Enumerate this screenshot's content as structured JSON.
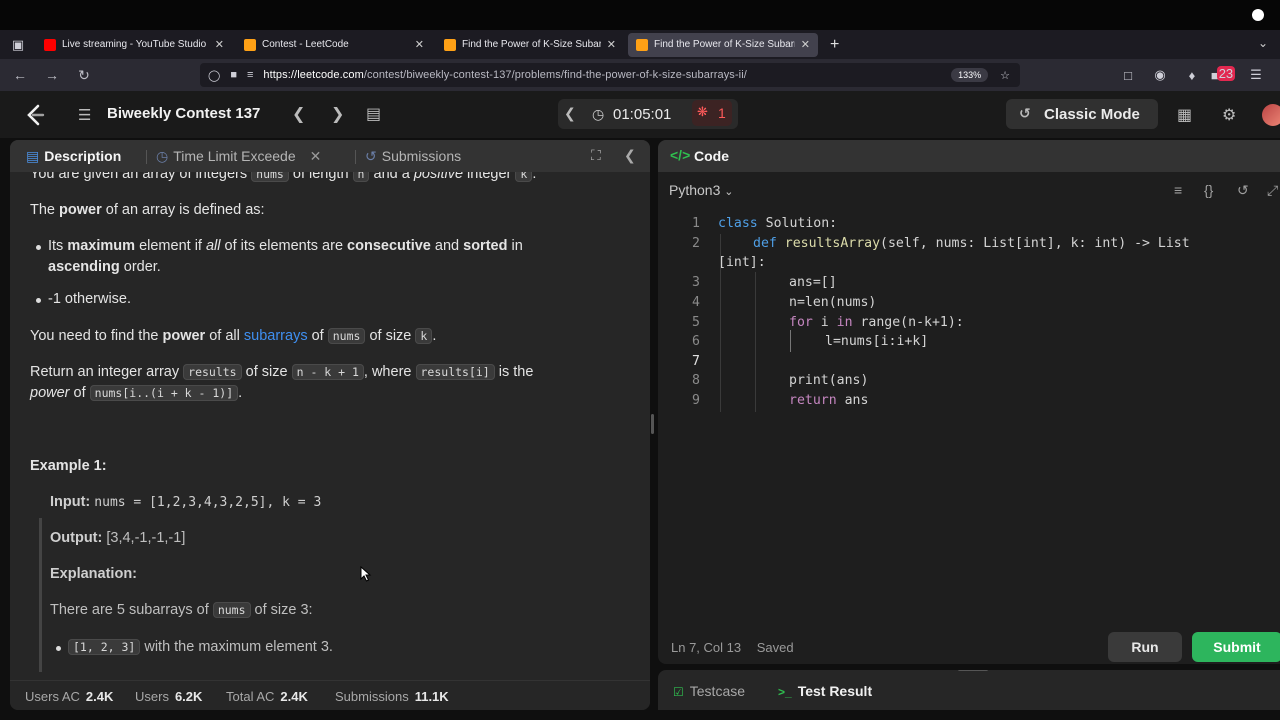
{
  "browser": {
    "tabs": [
      {
        "label": "Live streaming - YouTube Studio",
        "icon": "youtube-icon",
        "color": "#ff0000"
      },
      {
        "label": "Contest - LeetCode",
        "icon": "leetcode-icon",
        "color": "#ffa116"
      },
      {
        "label": "Find the Power of K-Size Subarr",
        "icon": "leetcode-icon",
        "color": "#ffa116"
      },
      {
        "label": "Find the Power of K-Size Subarr",
        "icon": "leetcode-icon",
        "color": "#ffa116",
        "active": true
      }
    ],
    "new_tab": "+",
    "url_domain": "https://leetcode.com",
    "url_path": "/contest/biweekly-contest-137/problems/find-the-power-of-k-size-subarrays-ii/",
    "zoom": "133%",
    "extension_badge": "23"
  },
  "header": {
    "contest_title": "Biweekly Contest 137",
    "timer": "01:05:01",
    "bug_count": "1",
    "mode_label": "Classic Mode"
  },
  "left": {
    "tabs": {
      "description": "Description",
      "tle": "Time Limit Exceede",
      "submissions": "Submissions"
    },
    "desc": {
      "line0_a": "You are given an array of integers",
      "line0_code1": "nums",
      "line0_b": "of length",
      "line0_code2": "n",
      "line0_c": "and a",
      "line0_em": "positive",
      "line0_d": "integer",
      "line0_code3": "k",
      "line0_e": ".",
      "p1_a": "The",
      "p1_b": "power",
      "p1_c": "of an array is defined as:",
      "b1_a": "Its",
      "b1_b": "maximum",
      "b1_c": "element if",
      "b1_d": "all",
      "b1_e": "of its elements are",
      "b1_f": "consecutive",
      "b1_g": "and",
      "b1_h": "sorted",
      "b1_i": "in",
      "b1_j": "ascending",
      "b1_k": "order.",
      "b2": "-1 otherwise.",
      "p2_a": "You need to find the",
      "p2_b": "power",
      "p2_c": "of all",
      "p2_link": "subarrays",
      "p2_d": "of",
      "p2_code1": "nums",
      "p2_e": "of size",
      "p2_code2": "k",
      "p2_f": ".",
      "p3_a": "Return an integer array",
      "p3_code1": "results",
      "p3_b": "of size",
      "p3_code2": "n - k + 1",
      "p3_c": ", where",
      "p3_code3": "results[i]",
      "p3_d": "is the",
      "p3_em": "power",
      "p3_e": "of",
      "p3_code4": "nums[i..(i + k - 1)]",
      "p3_f": ".",
      "example_title": "Example 1:",
      "input_label": "Input:",
      "input_value": "nums = [1,2,3,4,3,2,5], k = 3",
      "output_label": "Output:",
      "output_value": "[3,4,-1,-1,-1]",
      "expl_label": "Explanation:",
      "expl_a": "There are 5 subarrays of",
      "expl_code": "nums",
      "expl_b": "of size 3:",
      "sub1_code": "[1, 2, 3]",
      "sub1_text": "with the maximum element 3."
    },
    "footer": {
      "users_ac_label": "Users AC",
      "users_ac": "2.4K",
      "users_label": "Users",
      "users": "6.2K",
      "total_ac_label": "Total AC",
      "total_ac": "2.4K",
      "submissions_label": "Submissions",
      "submissions": "11.1K"
    }
  },
  "right": {
    "code_tab": "Code",
    "language": "Python3",
    "code_lines": [
      {
        "n": "1"
      },
      {
        "n": "2"
      },
      {
        "n": "3"
      },
      {
        "n": "4"
      },
      {
        "n": "5"
      },
      {
        "n": "6"
      },
      {
        "n": "7"
      },
      {
        "n": "8"
      },
      {
        "n": "9"
      }
    ],
    "code": {
      "l1_kw": "class",
      "l1_rest": " Solution:",
      "l2_kw": "def",
      "l2_fn": " resultsArray",
      "l2_rest": "(self, nums: List[int], k: int) -> List",
      "l2_wrap": "[int]:",
      "l3": "ans=[]",
      "l4": "n=len(nums)",
      "l5_kw": "for",
      "l5_a": " i ",
      "l5_kw2": "in",
      "l5_b": " range(n-k+1):",
      "l6": "l=nums[i:i+k]",
      "l8": "print(ans)",
      "l9_kw": "return",
      "l9_rest": " ans"
    },
    "status": {
      "pos": "Ln 7, Col 13",
      "saved": "Saved"
    },
    "run": "Run",
    "submit": "Submit"
  },
  "bottom": {
    "testcase": "Testcase",
    "test_result": "Test Result"
  }
}
